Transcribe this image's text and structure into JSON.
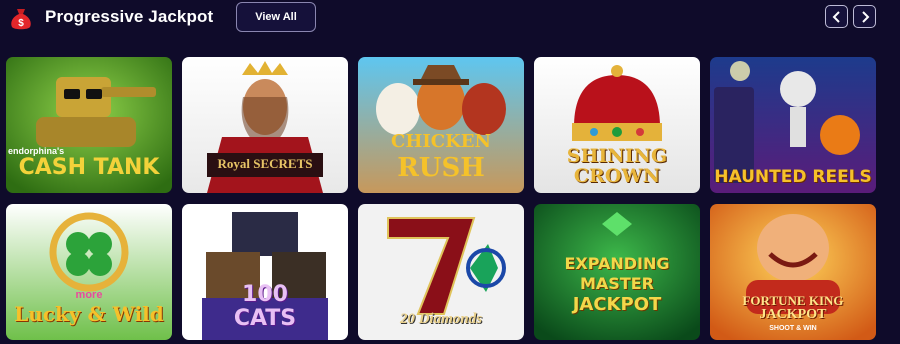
{
  "header": {
    "title": "Progressive Jackpot",
    "view_all_label": "View All",
    "icon": "money-bag-icon",
    "prev_icon": "chevron-left-icon",
    "next_icon": "chevron-right-icon"
  },
  "colors": {
    "background": "#0f0b2a",
    "button_border": "#8a86b0",
    "bag_red": "#e3262a"
  },
  "games": [
    {
      "title": "CASH TANK",
      "brand": "endorphina's"
    },
    {
      "title_line1": "Royal",
      "title_line2": "SECRETS"
    },
    {
      "title_line1": "CHICKEN",
      "title_line2": "RUSH"
    },
    {
      "title_line1": "SHINING",
      "title_line2": "CROWN"
    },
    {
      "title": "HAUNTED REELS"
    },
    {
      "title_line1": "more",
      "title_line2": "Lucky & Wild"
    },
    {
      "title_line1": "100",
      "title_line2": "CATS"
    },
    {
      "title": "20 Diamonds"
    },
    {
      "title_line1": "EXPANDING",
      "title_line2": "MASTER",
      "title_line3": "JACKPOT"
    },
    {
      "title_line1": "FORTUNE KING",
      "title_line2": "JACKPOT",
      "title_line3": "SHOOT & WIN"
    }
  ]
}
